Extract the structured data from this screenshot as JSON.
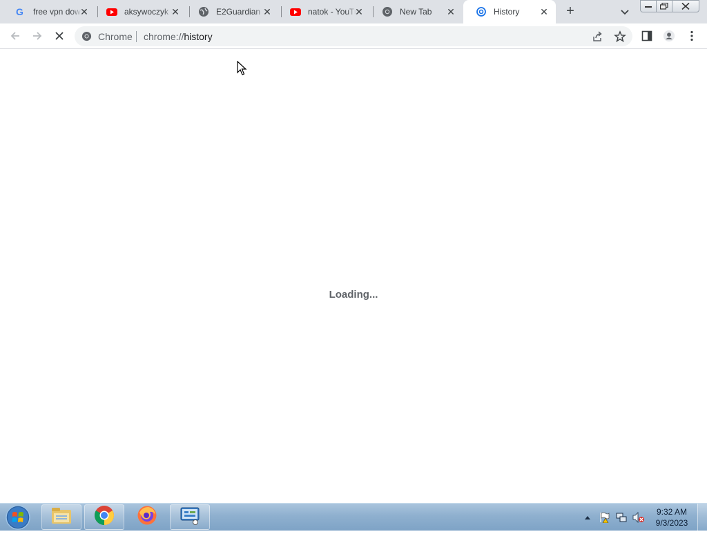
{
  "tabs": [
    {
      "title": "free vpn download",
      "icon": "google-icon"
    },
    {
      "title": "aksywoczyk - YouTube",
      "icon": "youtube-icon"
    },
    {
      "title": "E2Guardian",
      "icon": "globe-icon"
    },
    {
      "title": "natok - YouTube",
      "icon": "youtube-icon"
    },
    {
      "title": "New Tab",
      "icon": "chrome-icon"
    },
    {
      "title": "History",
      "icon": "history-icon"
    }
  ],
  "omnibox": {
    "chip_label": "Chrome",
    "url_scheme": "chrome://",
    "url_host": "history"
  },
  "page": {
    "status_text": "Loading..."
  },
  "taskbar": {
    "time": "9:32 AM",
    "date": "9/3/2023"
  },
  "colors": {
    "tabstrip": "#dee1e6",
    "omnibox": "#f1f3f4",
    "taskbar": "#8fb0cf",
    "loading_text": "#5f6368"
  }
}
